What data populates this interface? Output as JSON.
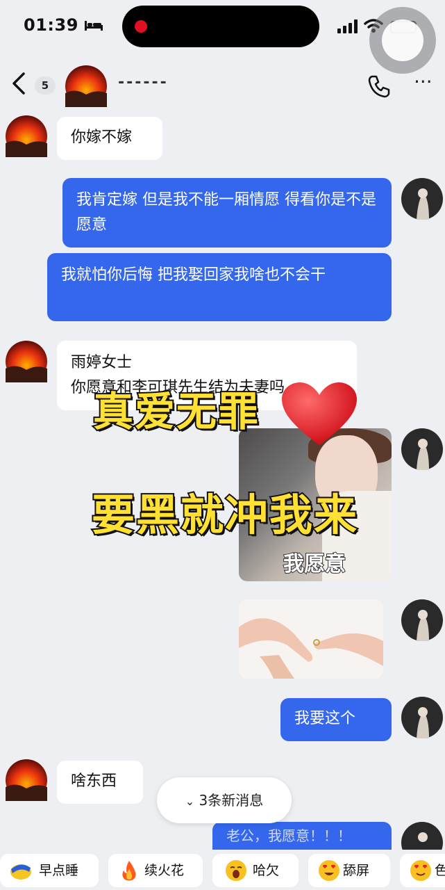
{
  "status": {
    "time": "01:39"
  },
  "chat": {
    "unread": "5",
    "title": "------"
  },
  "messages": {
    "m1": "你嫁不嫁",
    "m2": "我肯定嫁 但是我不能一厢情愿 得看你是不是愿意",
    "m3": "我就怕你后悔 把我娶回家我啥也不会干",
    "m4_line1": "雨婷女士",
    "m4_line2": "你愿意和李可琪先生结为夫妻吗",
    "sticker_caption": "我愿意",
    "m6": "我要这个",
    "m7": "啥东西",
    "partial": "老公，我愿意！！！"
  },
  "overlay": {
    "line1": "真爱无罪",
    "line2": "要黑就冲我来"
  },
  "new_messages": "3条新消息",
  "quick_replies": [
    {
      "label": "早点睡",
      "icon": "sleep-emoji-icon"
    },
    {
      "label": "续火花",
      "icon": "fire-icon"
    },
    {
      "label": "哈欠",
      "icon": "yawn-emoji-icon"
    },
    {
      "label": "舔屏",
      "icon": "heart-eyes-emoji-icon"
    },
    {
      "label": "色",
      "icon": "heart-eyes-emoji-icon"
    }
  ],
  "colors": {
    "outgoing_bubble": "#3467ec",
    "incoming_bubble": "#ffffff",
    "overlay_text": "#ffe033",
    "background": "#eeeff2"
  }
}
